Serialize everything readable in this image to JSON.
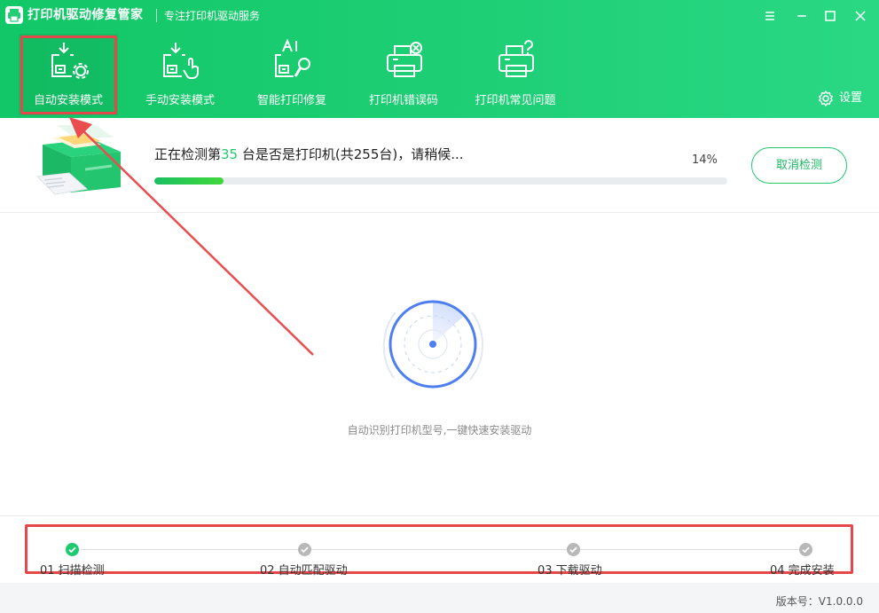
{
  "window": {
    "title": "打印机驱动修复管家",
    "subtitle": "专注打印机驱动服务"
  },
  "nav": {
    "items": [
      {
        "label": "自动安装模式",
        "icon": "auto-install-icon",
        "active": true
      },
      {
        "label": "手动安装模式",
        "icon": "manual-install-icon",
        "active": false
      },
      {
        "label": "智能打印修复",
        "icon": "ai-repair-icon",
        "active": false
      },
      {
        "label": "打印机错误码",
        "icon": "printer-error-icon",
        "active": false
      },
      {
        "label": "打印机常见问题",
        "icon": "printer-faq-icon",
        "active": false
      }
    ],
    "settings_label": "设置"
  },
  "progress": {
    "text_prefix": "正在检测第",
    "current_count": "35",
    "text_suffix": " 台是否是打印机(共255台)，请稍候...",
    "percent_label": "14%",
    "fraction": 0.12,
    "cancel_label": "取消检测"
  },
  "center": {
    "hint": "自动识别打印机型号,一键快速安装驱动"
  },
  "steps": [
    {
      "label": "01 扫描检测",
      "status": "done"
    },
    {
      "label": "02 自动匹配驱动",
      "status": "pending"
    },
    {
      "label": "03 下载驱动",
      "status": "pending"
    },
    {
      "label": "04 完成安装",
      "status": "pending"
    }
  ],
  "footer": {
    "version": "版本号：V1.0.0.0"
  },
  "colors": {
    "brand_green": "#1fcf76",
    "highlight_red": "#e5474b",
    "radar_blue": "#4d7ff0"
  }
}
